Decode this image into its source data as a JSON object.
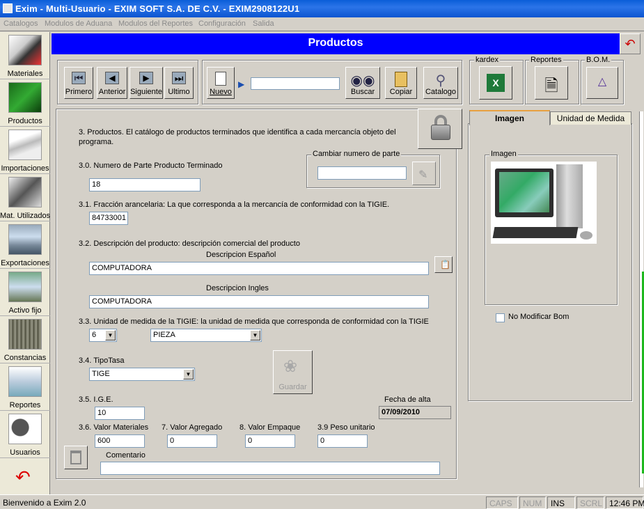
{
  "window": {
    "title": "Exim - Multi-Usuario - EXIM SOFT S.A. DE C.V. - EXIM2908122U1"
  },
  "menu": [
    "Catalogos",
    "Modulos de Aduana",
    "Modulos del Reportes",
    "Configuración",
    "Salida"
  ],
  "sidebar": {
    "items": [
      {
        "label": "Materiales",
        "icon": "materials-icon"
      },
      {
        "label": "Productos",
        "icon": "circuit-board-icon"
      },
      {
        "label": "Importaciones",
        "icon": "airplane-icon"
      },
      {
        "label": "Mat. Utilizados",
        "icon": "parts-icon"
      },
      {
        "label": "Exportaciones",
        "icon": "ship-icon"
      },
      {
        "label": "Activo fijo",
        "icon": "building-icon"
      },
      {
        "label": "Constancias",
        "icon": "files-icon"
      },
      {
        "label": "Reportes",
        "icon": "printer-icon"
      },
      {
        "label": "Usuarios",
        "icon": "lock-user-icon"
      },
      {
        "label": "",
        "icon": "back-arrow-icon"
      }
    ]
  },
  "header": {
    "title": "Productos"
  },
  "toolbar": {
    "nav": [
      "Primero",
      "Anterior",
      "Siguiente",
      "Ultimo"
    ],
    "nuevo": "Nuevo",
    "buscar": "Buscar",
    "copiar": "Copiar",
    "catalogo": "Catalogo",
    "search_value": "",
    "kardex": "kardex",
    "reportes": "Reportes",
    "bom": "B.O.M."
  },
  "form": {
    "intro": "3. Productos. El catálogo de productos terminados que identifica a cada mercancía objeto  del programa.",
    "numero_parte_label": "3.0. Numero de Parte Producto Terminado",
    "numero_parte_value": "18",
    "cambiar_label": "Cambiar numero de parte",
    "cambiar_value": "",
    "fraccion_label": "3.1. Fracción arancelaria: La que corresponda a la mercancía de conformidad con la TIGIE.",
    "fraccion_value": "84733001",
    "descripcion_label": "3.2. Descripción del producto: descripción comercial del producto",
    "desc_es_label": "Descripcion Español",
    "desc_es_value": "COMPUTADORA",
    "desc_en_label": "Descripcion Ingles",
    "desc_en_value": "COMPUTADORA",
    "unidad_label": "3.3. Unidad de medida de la TIGIE: la unidad de medida que corresponda de conformidad con la TIGIE",
    "unidad_code": "6",
    "unidad_name": "PIEZA",
    "tipotasa_label": "3.4. TipoTasa",
    "tipotasa_value": "TIGE",
    "guardar": "Guardar",
    "ige_label": "3.5.  I.G.E.",
    "ige_value": "10",
    "fecha_label": "Fecha de alta",
    "fecha_value": "07/09/2010",
    "valor_mat_label": "3.6.  Valor Materiales",
    "valor_mat_value": "600",
    "valor_agr_label": "7.  Valor Agregado",
    "valor_agr_value": "0",
    "valor_emp_label": "8.  Valor Empaque",
    "valor_emp_value": "0",
    "peso_label": "3.9 Peso unitario",
    "peso_value": "0",
    "comentario_label": "Comentario",
    "comentario_value": ""
  },
  "right_panel": {
    "tabs": [
      "Imagen",
      "Unidad de Medida"
    ],
    "imagen_group": "Imagen",
    "no_modificar": "No Modificar Bom"
  },
  "status": {
    "message": "Bienvenido a Exim 2.0",
    "caps": "CAPS",
    "num": "NUM",
    "ins": "INS",
    "scrl": "SCRL",
    "time": "12:46 PM"
  }
}
